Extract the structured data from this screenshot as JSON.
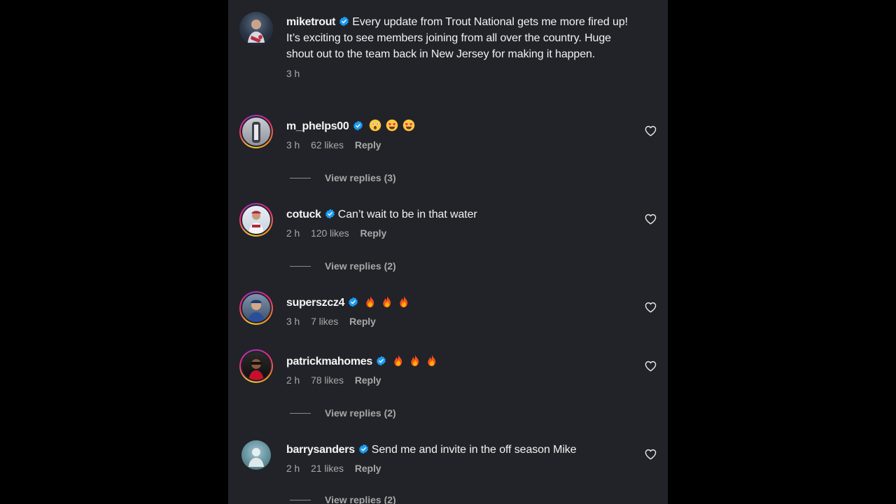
{
  "comments": [
    {
      "username": "miketrout",
      "text": "Every update from Trout National gets me more fired up! It’s exciting to see members joining from all over the country. Huge shout out to the team back in New Jersey for making it happen.",
      "time": "3 h"
    },
    {
      "username": "m_phelps00",
      "emojis": [
        "astonished-face",
        "heart-eyes",
        "heart-eyes"
      ],
      "time": "3 h",
      "likes": "62 likes",
      "reply": "Reply",
      "view_replies": "View replies (3)"
    },
    {
      "username": "cotuck",
      "text": "Can’t wait to be in that water",
      "time": "2 h",
      "likes": "120 likes",
      "reply": "Reply",
      "view_replies": "View replies (2)"
    },
    {
      "username": "superszcz4",
      "emojis": [
        "fire",
        "fire",
        "fire"
      ],
      "time": "3 h",
      "likes": "7 likes",
      "reply": "Reply"
    },
    {
      "username": "patrickmahomes",
      "emojis": [
        "fire",
        "fire",
        "fire"
      ],
      "time": "2 h",
      "likes": "78 likes",
      "reply": "Reply",
      "view_replies": "View replies (2)"
    },
    {
      "username": "barrysanders",
      "text": "Send me and invite in the off season Mike",
      "time": "2 h",
      "likes": "21 likes",
      "reply": "Reply",
      "view_replies": "View replies (2)"
    }
  ],
  "colors": {
    "panel_bg": "#212328",
    "verified": "#1d9bf0",
    "meta_text": "#a8a8a8"
  }
}
